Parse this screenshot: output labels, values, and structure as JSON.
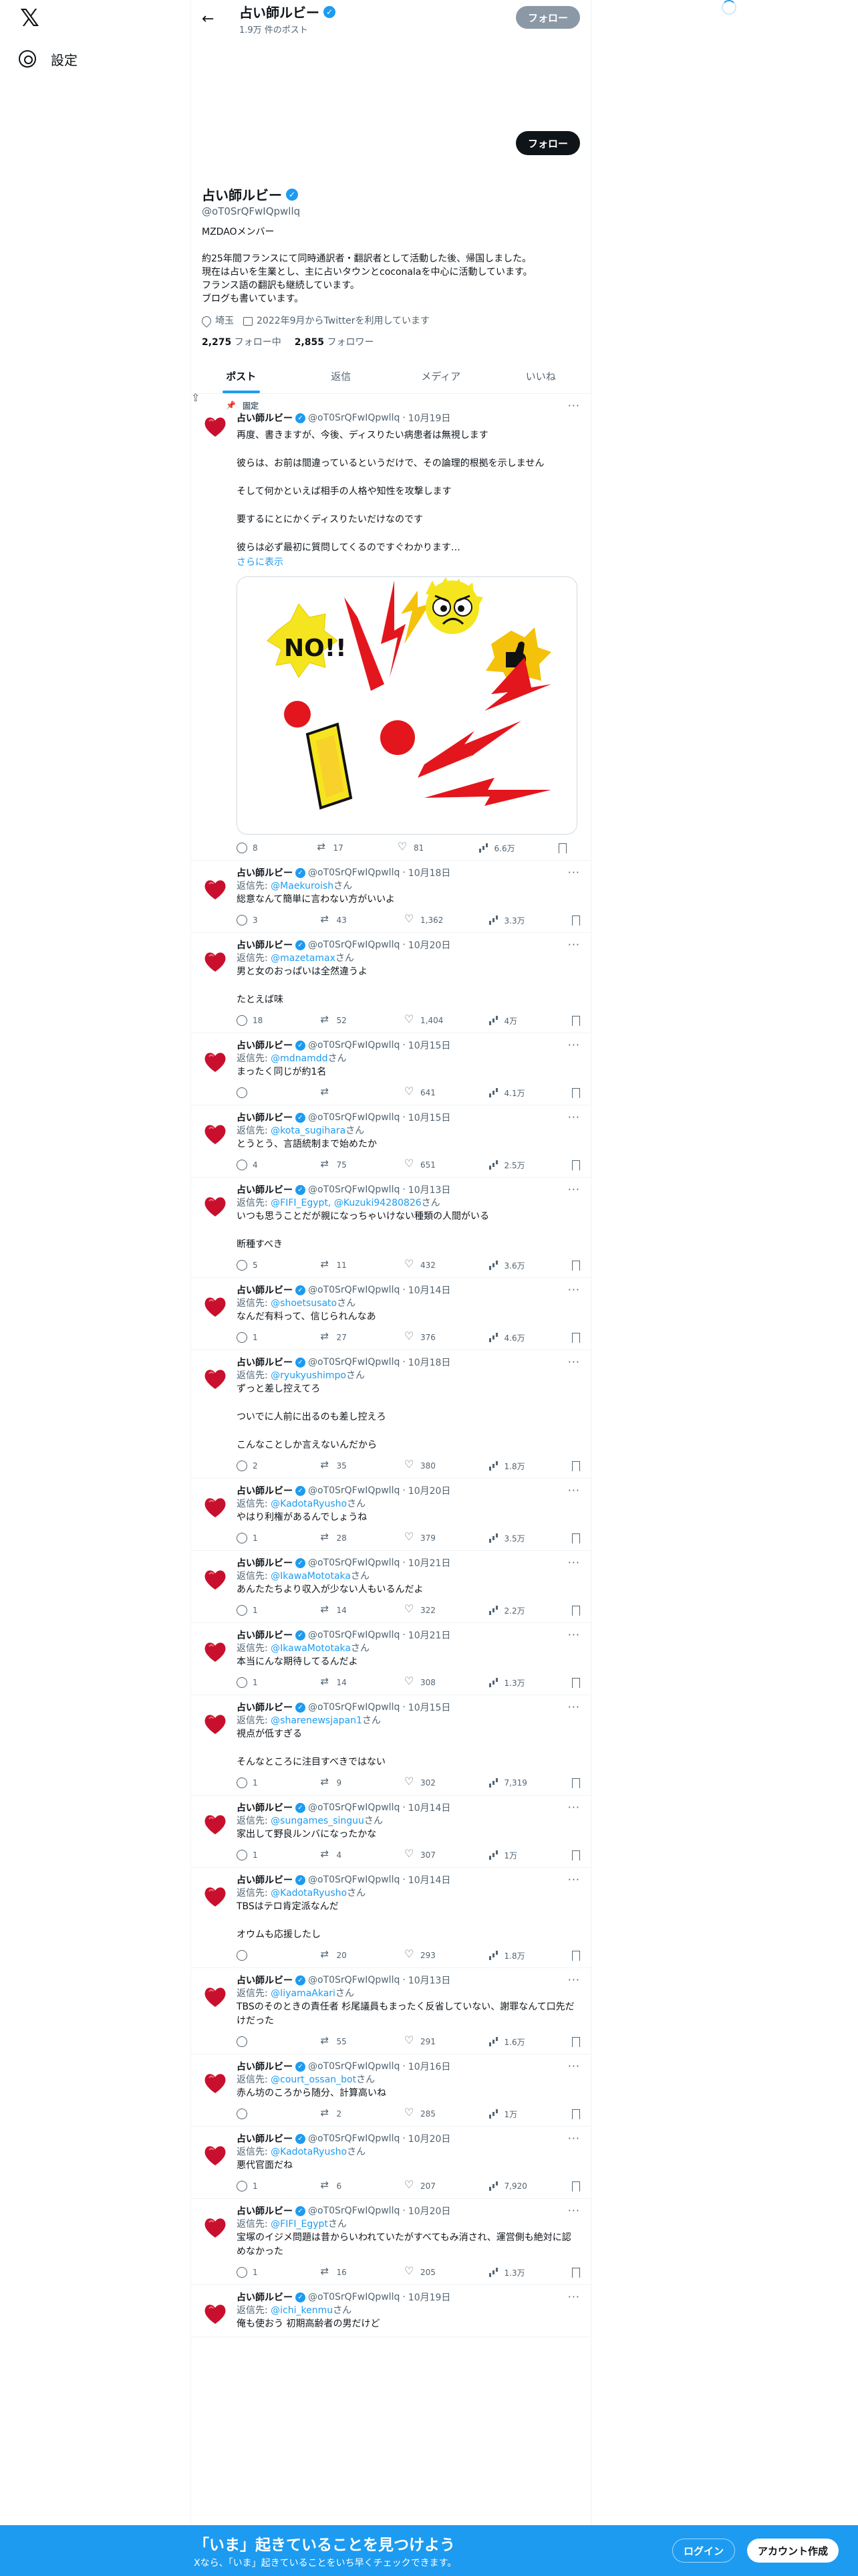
{
  "nav": {
    "settings_label": "設定"
  },
  "header": {
    "name": "占い師ルビー",
    "post_count": "1.9万 件のポスト",
    "follow_label": "フォロー"
  },
  "profile": {
    "name": "占い師ルビー",
    "handle": "@oT0SrQFwIQpwllq",
    "follow_label": "フォロー",
    "bio": "MZDAOメンバー\n\n約25年間フランスにて同時通訳者・翻訳者として活動した後、帰国しました。\n現在は占いを生業とし、主に占いタウンとcoconalaを中心に活動しています。\nフランス語の翻訳も継続しています。\nブログも書いています。",
    "location": "埼玉",
    "joined": "2022年9月からTwitterを利用しています",
    "following_count": "2,275",
    "following_label": "フォロー中",
    "followers_count": "2,855",
    "followers_label": "フォロワー"
  },
  "tabs": [
    "ポスト",
    "返信",
    "メディア",
    "いいね"
  ],
  "pinned_label": "固定",
  "show_more": "さらに表示",
  "reply_prefix": "返信先: ",
  "reply_suffix": "さん",
  "tweets": [
    {
      "date": "10月19日",
      "reply_to": "",
      "text": "再度、書きますが、今後、ディスりたい病患者は無視します\n\n彼らは、お前は間違っているというだけで、その論理的根拠を示しません\n\nそして何かといえば相手の人格や知性を攻撃します\n\n要するにとにかくディスりたいだけなのです\n\n彼らは必ず最初に質問してくるのですぐわかります…",
      "replies": "8",
      "retweets": "17",
      "likes": "81",
      "views": "6.6万"
    },
    {
      "date": "10月18日",
      "reply_to": "@Maekuroish",
      "text": "総意なんて簡単に言わない方がいいよ",
      "replies": "3",
      "retweets": "43",
      "likes": "1,362",
      "views": "3.3万"
    },
    {
      "date": "10月20日",
      "reply_to": "@mazetamax",
      "text": "男と女のおっぱいは全然違うよ\n\nたとえば味",
      "replies": "18",
      "retweets": "52",
      "likes": "1,404",
      "views": "4万"
    },
    {
      "date": "10月15日",
      "reply_to": "@mdnamdd",
      "text": "まったく同じが約1名",
      "replies": "",
      "retweets": "",
      "likes": "641",
      "views": "4.1万"
    },
    {
      "date": "10月15日",
      "reply_to": "@kota_sugihara",
      "text": "とうとう、言語統制まで始めたか",
      "replies": "4",
      "retweets": "75",
      "likes": "651",
      "views": "2.5万"
    },
    {
      "date": "10月13日",
      "reply_to": "@FIFI_Egypt, @Kuzuki94280826",
      "text": "いつも思うことだが親になっちゃいけない種類の人間がいる\n\n断種すべき",
      "replies": "5",
      "retweets": "11",
      "likes": "432",
      "views": "3.6万"
    },
    {
      "date": "10月14日",
      "reply_to": "@shoetsusato",
      "text": "なんだ有料って、信じられんなあ",
      "replies": "1",
      "retweets": "27",
      "likes": "376",
      "views": "4.6万"
    },
    {
      "date": "10月18日",
      "reply_to": "@ryukyushimpo",
      "text": "ずっと差し控えてろ\n\nついでに人前に出るのも差し控えろ\n\nこんなことしか言えないんだから",
      "replies": "2",
      "retweets": "35",
      "likes": "380",
      "views": "1.8万"
    },
    {
      "date": "10月20日",
      "reply_to": "@KadotaRyusho",
      "text": "やはり利権があるんでしょうね",
      "replies": "1",
      "retweets": "28",
      "likes": "379",
      "views": "3.5万"
    },
    {
      "date": "10月21日",
      "reply_to": "@IkawaMototaka",
      "text": "あんたたちより収入が少ない人もいるんだよ",
      "replies": "1",
      "retweets": "14",
      "likes": "322",
      "views": "2.2万"
    },
    {
      "date": "10月21日",
      "reply_to": "@IkawaMototaka",
      "text": "本当にんな期待してるんだよ",
      "replies": "1",
      "retweets": "14",
      "likes": "308",
      "views": "1.3万"
    },
    {
      "date": "10月15日",
      "reply_to": "@sharenewsjapan1",
      "text": "視点が低すぎる\n\nそんなところに注目すべきではない",
      "replies": "1",
      "retweets": "9",
      "likes": "302",
      "views": "7,319"
    },
    {
      "date": "10月14日",
      "reply_to": "@sungames_singuu",
      "text": "家出して野良ルンバになったかな",
      "replies": "1",
      "retweets": "4",
      "likes": "307",
      "views": "1万"
    },
    {
      "date": "10月14日",
      "reply_to": "@KadotaRyusho",
      "text": "TBSはテロ肯定派なんだ\n\nオウムも応援したし",
      "replies": "",
      "retweets": "20",
      "likes": "293",
      "views": "1.8万"
    },
    {
      "date": "10月13日",
      "reply_to": "@IiyamaAkari",
      "text": "TBSのそのときの責任者 杉尾議員もまったく反省していない、謝罪なんて口先だけだった",
      "replies": "",
      "retweets": "55",
      "likes": "291",
      "views": "1.6万"
    },
    {
      "date": "10月16日",
      "reply_to": "@court_ossan_bot",
      "text": "赤ん坊のころから随分、計算高いね",
      "replies": "",
      "retweets": "2",
      "likes": "285",
      "views": "1万"
    },
    {
      "date": "10月20日",
      "reply_to": "@KadotaRyusho",
      "text": "悪代官面だね",
      "replies": "1",
      "retweets": "6",
      "likes": "207",
      "views": "7,920"
    },
    {
      "date": "10月20日",
      "reply_to": "@FIFI_Egypt",
      "text": "宝塚のイジメ問題は昔からいわれていたがすべてもみ消され、運営側も絶対に認めなかった",
      "replies": "1",
      "retweets": "16",
      "likes": "205",
      "views": "1.3万"
    },
    {
      "date": "10月19日",
      "reply_to": "@ichi_kenmu",
      "text": "俺も使おう 初期高齢者の男だけど",
      "replies": "",
      "retweets": "",
      "likes": "",
      "views": ""
    }
  ],
  "bottom": {
    "title": "「いま」起きていることを見つけよう",
    "subtitle": "Xなら、「いま」起きていることをいち早くチェックできます。",
    "login_label": "ログイン",
    "signup_label": "アカウント作成"
  },
  "icons": [
    "x-logo-icon",
    "gear-icon",
    "back-arrow-icon",
    "verified-icon",
    "more-icon",
    "reply-icon",
    "retweet-icon",
    "like-icon",
    "views-icon",
    "bookmark-icon",
    "share-icon",
    "pin-icon",
    "location-icon",
    "calendar-icon"
  ],
  "colors": {
    "accent": "#1d9bf0",
    "text": "#0f1419",
    "muted": "#536471",
    "border": "#eff3f4"
  }
}
